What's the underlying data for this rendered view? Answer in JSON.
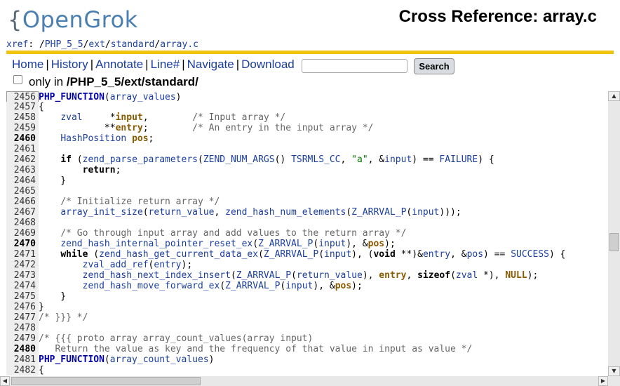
{
  "logo": {
    "open_brace": "{",
    "text": "OpenGrok"
  },
  "title": "Cross Reference: array.c",
  "breadcrumb": {
    "root": "xref",
    "sep0": ": /",
    "parts": [
      "PHP_5_5",
      "ext",
      "standard",
      "array.c"
    ],
    "slash": "/"
  },
  "menu": {
    "items": [
      "Home",
      "History",
      "Annotate",
      "Line#",
      "Navigate",
      "Download"
    ],
    "separator": "|"
  },
  "search": {
    "placeholder": "",
    "button_label": "Search"
  },
  "only_in": {
    "label": "only in",
    "path": "/PHP_5_5/ext/standard/"
  },
  "code_lines": [
    {
      "n": "2456",
      "bold": false,
      "html": "<span class='d'>PHP_FUNCTION</span>(<span class='i'>array_values</span>)"
    },
    {
      "n": "2457",
      "bold": false,
      "html": "{"
    },
    {
      "n": "2458",
      "bold": false,
      "html": "    <span class='i'>zval</span>     *<span class='v'>input</span>,        <span class='c'>/* Input array */</span>"
    },
    {
      "n": "2459",
      "bold": false,
      "html": "            **<span class='v'>entry</span>;        <span class='c'>/* An entry in the input array */</span>"
    },
    {
      "n": "2460",
      "bold": true,
      "html": "    <span class='i'>HashPosition</span> <span class='v'>pos</span>;"
    },
    {
      "n": "2461",
      "bold": false,
      "html": ""
    },
    {
      "n": "2462",
      "bold": false,
      "html": "    <span class='k'>if</span> (<span class='i'>zend_parse_parameters</span>(<span class='i'>ZEND_NUM_ARGS</span>() <span class='i'>TSRMLS_CC</span>, <span class='s'>\"a\"</span>, &amp;<span class='i'>input</span>) == <span class='i'>FAILURE</span>) {"
    },
    {
      "n": "2463",
      "bold": false,
      "html": "        <span class='k'>return</span>;"
    },
    {
      "n": "2464",
      "bold": false,
      "html": "    }"
    },
    {
      "n": "2465",
      "bold": false,
      "html": ""
    },
    {
      "n": "2466",
      "bold": false,
      "html": "    <span class='c'>/* Initialize return array */</span>"
    },
    {
      "n": "2467",
      "bold": false,
      "html": "    <span class='i'>array_init_size</span>(<span class='i'>return_value</span>, <span class='i'>zend_hash_num_elements</span>(<span class='i'>Z_ARRVAL_P</span>(<span class='i'>input</span>)));"
    },
    {
      "n": "2468",
      "bold": false,
      "html": ""
    },
    {
      "n": "2469",
      "bold": false,
      "html": "    <span class='c'>/* Go through input array and add values to the return array */</span>"
    },
    {
      "n": "2470",
      "bold": true,
      "html": "    <span class='i'>zend_hash_internal_pointer_reset_ex</span>(<span class='i'>Z_ARRVAL_P</span>(<span class='i'>input</span>), &amp;<span class='v'>pos</span>);"
    },
    {
      "n": "2471",
      "bold": false,
      "html": "    <span class='k'>while</span> (<span class='i'>zend_hash_get_current_data_ex</span>(<span class='i'>Z_ARRVAL_P</span>(<span class='i'>input</span>), (<span class='k'>void</span> **)&amp;<span class='i'>entry</span>, &amp;<span class='i'>pos</span>) == <span class='i'>SUCCESS</span>) {"
    },
    {
      "n": "2472",
      "bold": false,
      "html": "        <span class='i'>zval_add_ref</span>(<span class='i'>entry</span>);"
    },
    {
      "n": "2473",
      "bold": false,
      "html": "        <span class='i'>zend_hash_next_index_insert</span>(<span class='i'>Z_ARRVAL_P</span>(<span class='i'>return_value</span>), <span class='v'>entry</span>, <span class='k'>sizeof</span>(<span class='i'>zval</span> *), <span class='nl'>NULL</span>);"
    },
    {
      "n": "2474",
      "bold": false,
      "html": "        <span class='i'>zend_hash_move_forward_ex</span>(<span class='i'>Z_ARRVAL_P</span>(<span class='i'>input</span>), &amp;<span class='v'>pos</span>);"
    },
    {
      "n": "2475",
      "bold": false,
      "html": "    }"
    },
    {
      "n": "2476",
      "bold": false,
      "html": "}"
    },
    {
      "n": "2477",
      "bold": false,
      "html": "<span class='c'>/* }}} */</span>"
    },
    {
      "n": "2478",
      "bold": false,
      "html": ""
    },
    {
      "n": "2479",
      "bold": false,
      "html": "<span class='c'>/* {{{ proto array array_count_values(array input)</span>"
    },
    {
      "n": "2480",
      "bold": true,
      "html": "<span class='c'>   Return the value as key and the frequency of that value in input as value */</span>"
    },
    {
      "n": "2481",
      "bold": false,
      "html": "<span class='d'>PHP_FUNCTION</span>(<span class='i'>array_count_values</span>)"
    },
    {
      "n": "2482",
      "bold": false,
      "html": "{"
    }
  ]
}
